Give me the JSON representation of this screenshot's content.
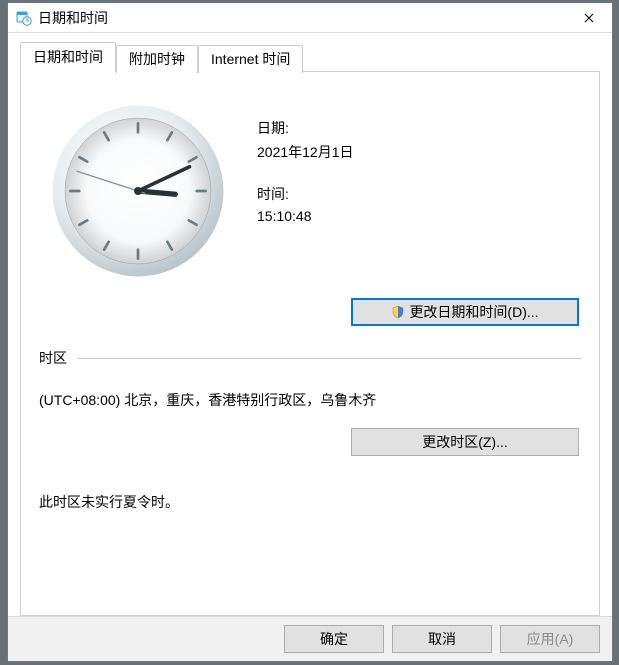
{
  "title": "日期和时间",
  "tabs": [
    {
      "label": "日期和时间"
    },
    {
      "label": "附加时钟"
    },
    {
      "label": "Internet 时间"
    }
  ],
  "date_label": "日期:",
  "date_value": "2021年12月1日",
  "time_label": "时间:",
  "time_value": "15:10:48",
  "change_datetime_btn": "更改日期和时间(D)...",
  "timezone_section_label": "时区",
  "timezone_value": "(UTC+08:00) 北京，重庆，香港特别行政区，乌鲁木齐",
  "change_timezone_btn": "更改时区(Z)...",
  "dst_note": "此时区未实行夏令时。",
  "footer": {
    "ok": "确定",
    "cancel": "取消",
    "apply": "应用(A)"
  },
  "icons": {
    "app": "calendar-clock-icon",
    "close": "close-icon",
    "shield": "shield-icon"
  },
  "clock": {
    "hour": 15,
    "minute": 10,
    "second": 48
  }
}
